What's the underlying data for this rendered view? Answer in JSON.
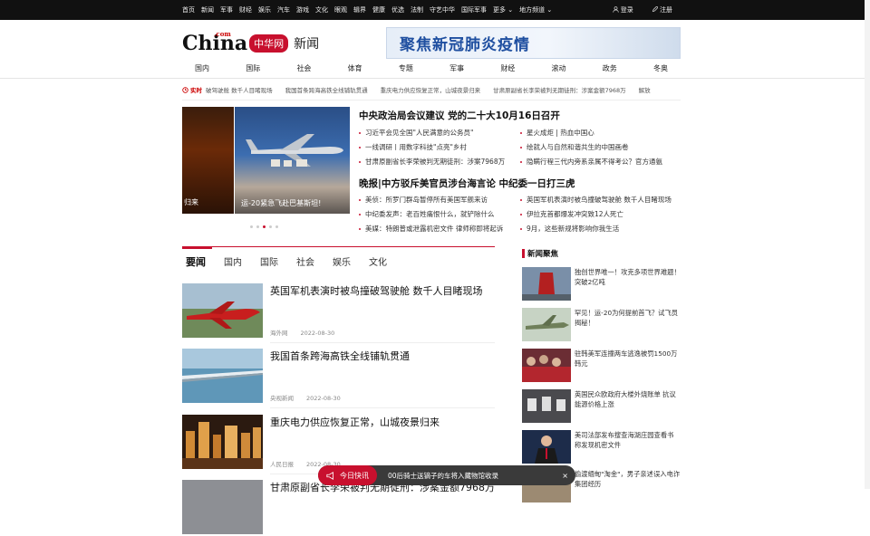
{
  "topbar": {
    "links": [
      "首页",
      "新闻",
      "军事",
      "财经",
      "娱乐",
      "汽车",
      "游戏",
      "文化",
      "眼观",
      "辑界",
      "健康",
      "优选",
      "法制",
      "守艺中华",
      "国际军事",
      "更多 ⌄",
      "地方频道 ⌄"
    ],
    "login": "登录",
    "register": "注册"
  },
  "brand": {
    "logo": "China",
    "logo_com": ".com",
    "logo_cn": "中华网",
    "section": "新闻",
    "banner": "聚焦新冠肺炎疫情"
  },
  "nav": [
    "国内",
    "国际",
    "社会",
    "体育",
    "专题",
    "军事",
    "财经",
    "滚动",
    "政务",
    "冬奥"
  ],
  "ticker": {
    "label": "实时",
    "items": [
      "破驾驶舱 数千人目睹现场",
      "我国首条跨海高铁全线铺轨贯通",
      "重庆电力供应恢复正常，山城夜景归来",
      "甘肃原副省长李荣被判无期徒刑：涉案金额7968万",
      "解放"
    ]
  },
  "carousel": {
    "left_caption": "归来",
    "main_caption": "运-20紧急飞赴巴基斯坦!",
    "active_dot": 3,
    "dot_count": 5
  },
  "headlines": {
    "h1": "中央政治局会议建议 党的二十大10月16日召开",
    "h1_left": [
      "习近平会见全国\"人民满意的公务员\"",
      "一线调研丨用数字科技\"点亮\"乡村",
      "甘肃原副省长李荣被判无期徒刑：涉案7968万"
    ],
    "h1_right": [
      "星火成炬 | 热血中国心",
      "绘就人与自然和谐共生的中国画卷",
      "隐瞒行程三代内旁系亲属不得考公？官方通氨"
    ],
    "h2": "晚报|中方驳斥美官员涉台海言论 中纪委一日打三虎",
    "h2_left": [
      "美侦：所罗门群岛暂停所有美国军舰来访",
      "中纪委发声：老百姓痛恨什么，就铲除什么",
      "美媒：特朗普或泄露机密文件 律师称即将起诉"
    ],
    "h2_right": [
      "英国军机表演时被鸟撞破驾驶舱 数千人目睹现场",
      "伊拉克首都爆发冲突致12人死亡",
      "9月，这些新规将影响你我生活"
    ]
  },
  "tabs": [
    "要闻",
    "国内",
    "国际",
    "社会",
    "娱乐",
    "文化"
  ],
  "articles": [
    {
      "title": "英国军机表演时被鸟撞破驾驶舱 数千人目睹现场",
      "source": "海外网",
      "date": "2022-08-30"
    },
    {
      "title": "我国首条跨海高铁全线铺轨贯通",
      "source": "央视新闻",
      "date": "2022-08-30"
    },
    {
      "title": "重庆电力供应恢复正常，山城夜景归来",
      "source": "人民日报",
      "date": "2022-08-30"
    },
    {
      "title": "甘肃原副省长李荣被判无期徒刑：涉案金额7968万",
      "source": "",
      "date": ""
    }
  ],
  "sidebar": {
    "heading": "新闻聚焦",
    "items": [
      "独创世界唯一！攻克多项世界难题！突破2亿吨",
      "罕见！运-20为何提前首飞？试飞员揭秘！",
      "驻韩美军连撞两车逃逸被罚1500万韩元",
      "英国民众欧政府大楼外烧账单 抗议能源价格上涨",
      "美司法部发布搜查海湖庄园查看书 称发现机密文件",
      "偷渡缅甸\"淘金\"，男子亲述误入电诈集团经历"
    ]
  },
  "flash": {
    "label": "今日快讯",
    "message": "00后骑士送镝子的车将入藏物馆收录",
    "close": "×"
  },
  "colors": {
    "brand_red": "#c8102e",
    "topbar": "#111111",
    "banner_text": "#1f4fa0"
  }
}
